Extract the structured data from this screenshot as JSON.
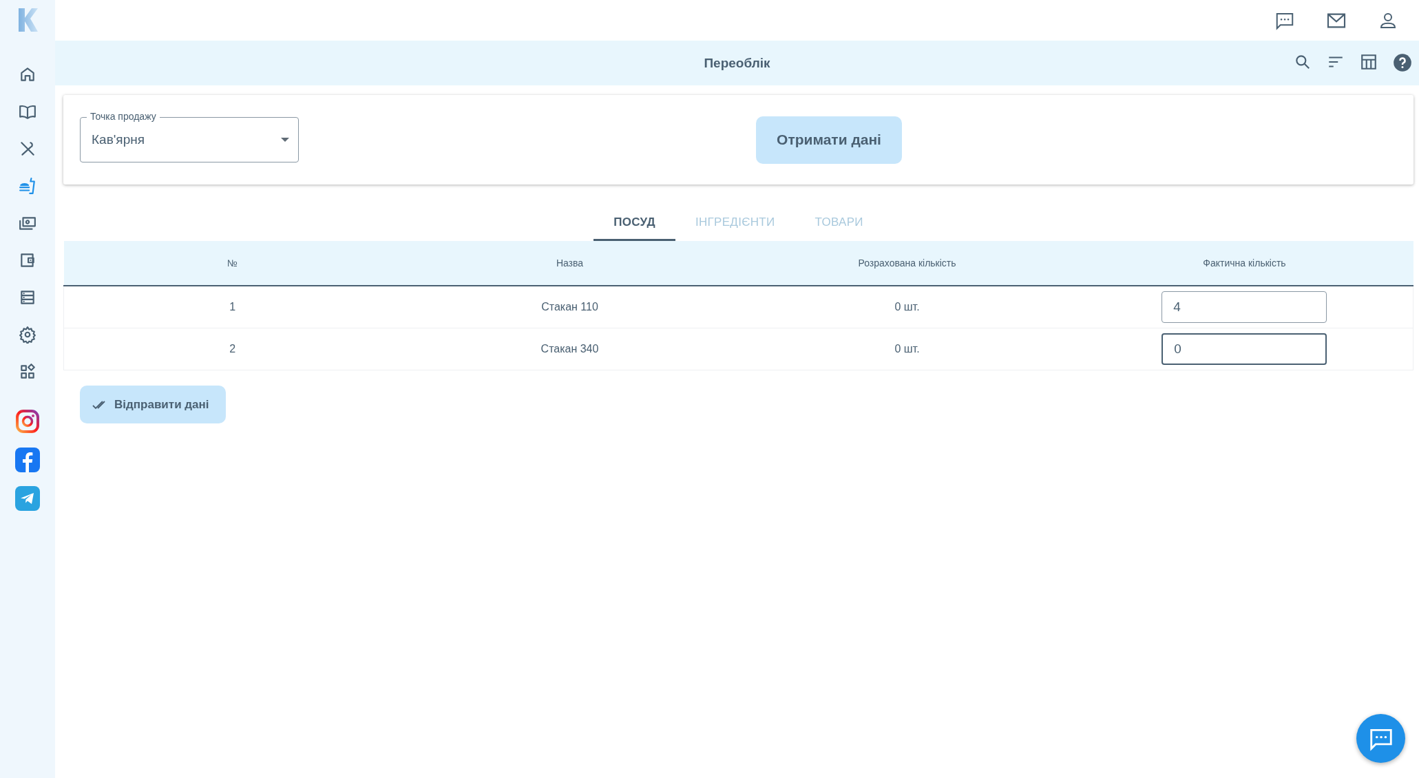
{
  "sidebar": {
    "items": [
      {
        "selected": false
      },
      {
        "selected": false
      },
      {
        "selected": false
      },
      {
        "selected": true
      },
      {
        "selected": false
      },
      {
        "selected": false
      },
      {
        "selected": false
      },
      {
        "selected": false
      },
      {
        "selected": false
      }
    ]
  },
  "header": {
    "title": "Переоблік"
  },
  "filter": {
    "select_label": "Точка продажу",
    "select_value": "Кав'ярня",
    "button": "Отримати дані"
  },
  "tabs": [
    {
      "label": "ПОСУД",
      "selected": true
    },
    {
      "label": "ІНГРЕДІЄНТИ",
      "selected": false
    },
    {
      "label": "ТОВАРИ",
      "selected": false
    }
  ],
  "table": {
    "columns": [
      "№",
      "Назва",
      "Розрахована кількість",
      "Фактична кількість"
    ],
    "rows": [
      {
        "number": "1",
        "name": "Стакан 110",
        "calculated": "0 шт.",
        "actual": "4",
        "focused": false
      },
      {
        "number": "2",
        "name": "Стакан 340",
        "calculated": "0 шт.",
        "actual": "0",
        "focused": true
      }
    ]
  },
  "submit_button": "Відправити дані"
}
